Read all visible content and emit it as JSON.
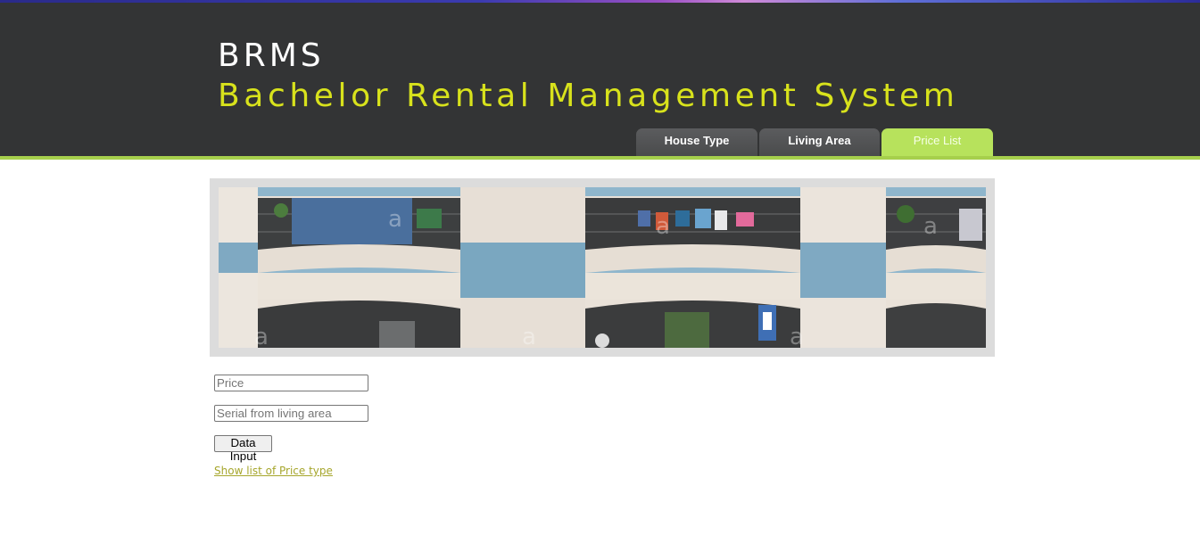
{
  "header": {
    "brand": "BRMS",
    "title": "Bachelor Rental Management System"
  },
  "nav": {
    "tabs": [
      {
        "label": "House Type",
        "active": false
      },
      {
        "label": "Living Area",
        "active": false
      },
      {
        "label": "Price List",
        "active": true
      }
    ]
  },
  "form": {
    "price_placeholder": "Price",
    "serial_placeholder": "Serial from living area",
    "submit_label": "Data Input"
  },
  "link": {
    "label": "Show list of Price type"
  },
  "colors": {
    "header_bg": "#333435",
    "accent_green": "#a6cf4c",
    "title_yellow": "#d8e21c",
    "link": "#a6a62c"
  }
}
